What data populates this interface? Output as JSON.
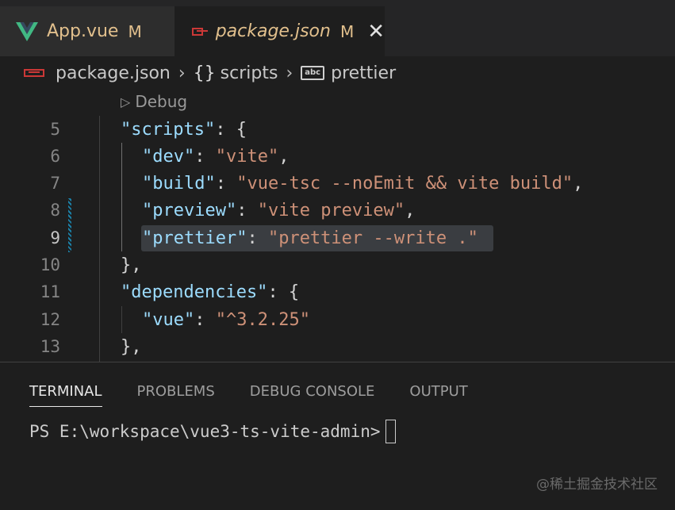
{
  "tabs": [
    {
      "label": "App.vue",
      "status": "M",
      "icon": "vue-icon"
    },
    {
      "label": "package.json",
      "status": "M",
      "icon": "npm-icon",
      "close": "✕"
    }
  ],
  "breadcrumb": {
    "file": "package.json",
    "section": "scripts",
    "item": "prettier",
    "section_icon": "{}",
    "item_icon": "abc"
  },
  "codelens": {
    "label": "Debug"
  },
  "editor": {
    "lines": [
      {
        "num": "5"
      },
      {
        "num": "6"
      },
      {
        "num": "7"
      },
      {
        "num": "8"
      },
      {
        "num": "9"
      },
      {
        "num": "10"
      },
      {
        "num": "11"
      },
      {
        "num": "12"
      },
      {
        "num": "13"
      }
    ],
    "tokens": {
      "scripts_key": "\"scripts\"",
      "colon_brace": ": {",
      "dev_key": "\"dev\"",
      "dev_val": "\"vite\"",
      "build_key": "\"build\"",
      "build_val": "\"vue-tsc --noEmit && vite build\"",
      "preview_key": "\"preview\"",
      "preview_val": "\"vite preview\"",
      "prettier_key": "\"prettier\"",
      "prettier_val": "\"prettier --write .\"",
      "close_comma": "},",
      "deps_key": "\"dependencies\"",
      "vue_key": "\"vue\"",
      "vue_val": "\"^3.2.25\"",
      "colon": ": ",
      "comma": ","
    }
  },
  "panel": {
    "tabs": [
      "TERMINAL",
      "PROBLEMS",
      "DEBUG CONSOLE",
      "OUTPUT"
    ],
    "prompt": "PS E:\\workspace\\vue3-ts-vite-admin>"
  },
  "watermark": "@稀土掘金技术社区",
  "colors": {
    "accent_modified": "#e2c08d",
    "key": "#9cdcfe",
    "string": "#ce9178",
    "background": "#1e1e1e"
  }
}
